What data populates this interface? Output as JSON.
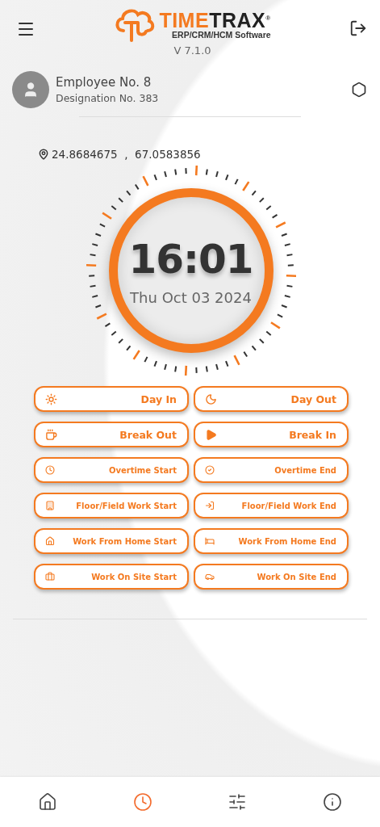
{
  "header": {
    "brand_primary": "TIME",
    "brand_secondary": "TRAX",
    "registered": "®",
    "tagline": "ERP/CRM/HCM Software",
    "version": "V 7.1.0"
  },
  "user": {
    "name": "Employee No. 8",
    "designation": "Designation No. 383"
  },
  "location": {
    "latitude": "24.8684675",
    "separator": ",",
    "longitude": "67.0583856"
  },
  "clock": {
    "time": "16:01",
    "date": "Thu Oct 03 2024"
  },
  "actions": [
    {
      "label": "Day In",
      "kind": "primary"
    },
    {
      "label": "Day Out",
      "kind": "primary"
    },
    {
      "label": "Break Out",
      "kind": "primary"
    },
    {
      "label": "Break In",
      "kind": "primary"
    },
    {
      "label": "Overtime Start",
      "kind": "secondary"
    },
    {
      "label": "Overtime End",
      "kind": "secondary"
    },
    {
      "label": "Floor/Field Work Start",
      "kind": "secondary"
    },
    {
      "label": "Floor/Field Work End",
      "kind": "secondary"
    },
    {
      "label": "Work From Home Start",
      "kind": "secondary"
    },
    {
      "label": "Work From Home End",
      "kind": "secondary"
    },
    {
      "label": "Work On Site Start",
      "kind": "secondary"
    },
    {
      "label": "Work On Site End",
      "kind": "secondary"
    }
  ],
  "nav": [
    {
      "selected": false
    },
    {
      "selected": true
    },
    {
      "selected": false
    },
    {
      "selected": false
    }
  ]
}
